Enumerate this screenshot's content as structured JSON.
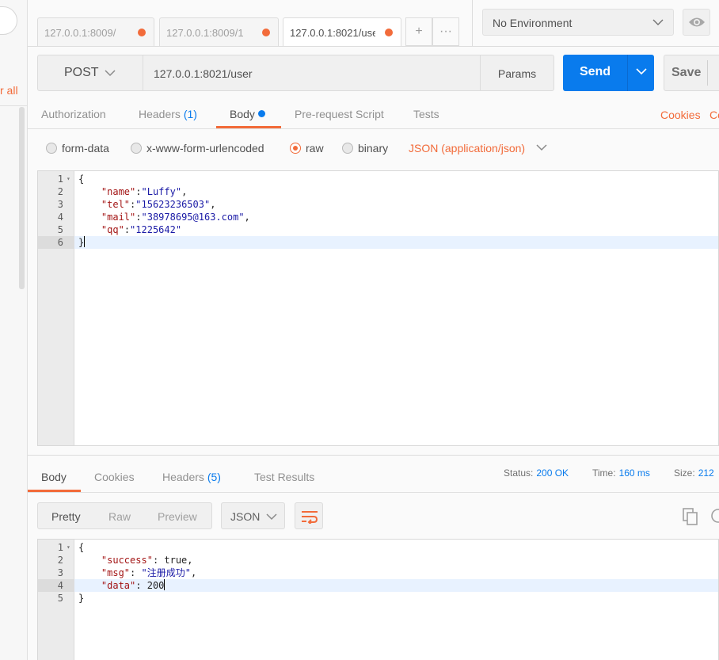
{
  "sidebar": {
    "link_text": "r all"
  },
  "tabs": [
    {
      "label": "127.0.0.1:8009/",
      "active": false,
      "unsaved": true
    },
    {
      "label": "127.0.0.1:8009/1",
      "active": false,
      "unsaved": true
    },
    {
      "label": "127.0.0.1:8021/user",
      "active": true,
      "unsaved": true
    }
  ],
  "tab_actions": {
    "add_label": "+",
    "more_label": "···"
  },
  "environment": {
    "selected": "No Environment"
  },
  "request": {
    "method": "POST",
    "url": "127.0.0.1:8021/user",
    "params_label": "Params",
    "send_label": "Send",
    "save_label": "Save"
  },
  "request_tabs": {
    "authorization": "Authorization",
    "headers": "Headers",
    "headers_count": "(1)",
    "body": "Body",
    "prerequest": "Pre-request Script",
    "tests": "Tests",
    "cookies": "Cookies",
    "code": "Co"
  },
  "body_types": {
    "form_data": "form-data",
    "urlencoded": "x-www-form-urlencoded",
    "raw": "raw",
    "binary": "binary",
    "selected": "raw",
    "content_type": "JSON (application/json)"
  },
  "request_body": [
    {
      "num": "1",
      "fold": true,
      "parts": [
        {
          "t": "p",
          "v": "{"
        }
      ]
    },
    {
      "num": "2",
      "fold": false,
      "parts": [
        {
          "t": "p",
          "v": "    "
        },
        {
          "t": "k",
          "v": "\"name\""
        },
        {
          "t": "p",
          "v": ":"
        },
        {
          "t": "s",
          "v": "\"Luffy\""
        },
        {
          "t": "p",
          "v": ","
        }
      ]
    },
    {
      "num": "3",
      "fold": false,
      "parts": [
        {
          "t": "p",
          "v": "    "
        },
        {
          "t": "k",
          "v": "\"tel\""
        },
        {
          "t": "p",
          "v": ":"
        },
        {
          "t": "s",
          "v": "\"15623236503\""
        },
        {
          "t": "p",
          "v": ","
        }
      ]
    },
    {
      "num": "4",
      "fold": false,
      "parts": [
        {
          "t": "p",
          "v": "    "
        },
        {
          "t": "k",
          "v": "\"mail\""
        },
        {
          "t": "p",
          "v": ":"
        },
        {
          "t": "s",
          "v": "\"38978695@163.com\""
        },
        {
          "t": "p",
          "v": ","
        }
      ]
    },
    {
      "num": "5",
      "fold": false,
      "parts": [
        {
          "t": "p",
          "v": "    "
        },
        {
          "t": "k",
          "v": "\"qq\""
        },
        {
          "t": "p",
          "v": ":"
        },
        {
          "t": "s",
          "v": "\"1225642\""
        }
      ]
    },
    {
      "num": "6",
      "fold": false,
      "active": true,
      "parts": [
        {
          "t": "p",
          "v": "}"
        }
      ]
    }
  ],
  "response_tabs": {
    "body": "Body",
    "cookies": "Cookies",
    "headers": "Headers",
    "headers_count": "(5)",
    "test_results": "Test Results"
  },
  "response_meta": {
    "status_label": "Status:",
    "status_value": "200 OK",
    "time_label": "Time:",
    "time_value": "160 ms",
    "size_label": "Size:",
    "size_value": "212"
  },
  "response_view": {
    "pretty": "Pretty",
    "raw": "Raw",
    "preview": "Preview",
    "format": "JSON"
  },
  "response_body": [
    {
      "num": "1",
      "fold": true,
      "parts": [
        {
          "t": "p",
          "v": "{"
        }
      ]
    },
    {
      "num": "2",
      "fold": false,
      "parts": [
        {
          "t": "p",
          "v": "    "
        },
        {
          "t": "k",
          "v": "\"success\""
        },
        {
          "t": "p",
          "v": ": true,"
        }
      ]
    },
    {
      "num": "3",
      "fold": false,
      "parts": [
        {
          "t": "p",
          "v": "    "
        },
        {
          "t": "k",
          "v": "\"msg\""
        },
        {
          "t": "p",
          "v": ": "
        },
        {
          "t": "s",
          "v": "\"注册成功\""
        },
        {
          "t": "p",
          "v": ","
        }
      ]
    },
    {
      "num": "4",
      "fold": false,
      "active": true,
      "parts": [
        {
          "t": "p",
          "v": "    "
        },
        {
          "t": "k",
          "v": "\"data\""
        },
        {
          "t": "p",
          "v": ": 200"
        }
      ]
    },
    {
      "num": "5",
      "fold": false,
      "parts": [
        {
          "t": "p",
          "v": "}"
        }
      ]
    }
  ],
  "colors": {
    "accent": "#f26b3a",
    "primary": "#097bed"
  }
}
